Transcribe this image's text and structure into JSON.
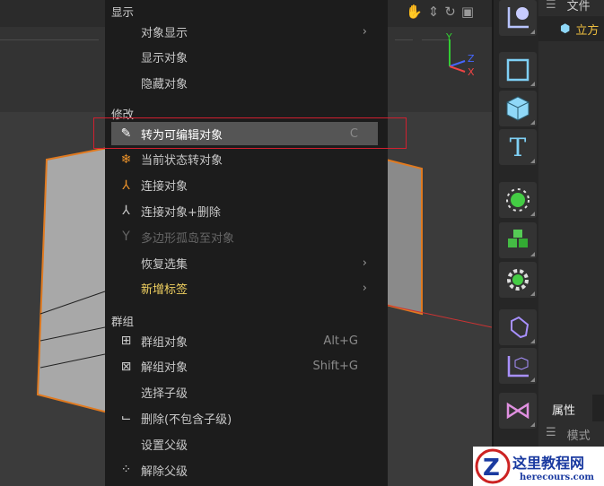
{
  "viewport": {
    "nav_icons": [
      "hand-icon",
      "move-icon",
      "rotate-icon",
      "maximize-icon"
    ],
    "axes": [
      "Y",
      "Z",
      "X"
    ]
  },
  "menu": {
    "sections": [
      {
        "title": "显示",
        "items": [
          {
            "label": "对象显示",
            "submenu": true
          },
          {
            "label": "显示对象"
          },
          {
            "label": "隐藏对象"
          }
        ]
      },
      {
        "title": "修改",
        "items": [
          {
            "label": "转为可编辑对象",
            "shortcut": "C",
            "icon": "edit-icon",
            "highlighted": true
          },
          {
            "label": "当前状态转对象",
            "icon": "snowflake-icon"
          },
          {
            "label": "连接对象",
            "icon": "connect-icon"
          },
          {
            "label": "连接对象+删除",
            "icon": "connect-delete-icon"
          },
          {
            "label": "多边形孤岛至对象",
            "icon": "polygon-island-icon",
            "disabled": true
          },
          {
            "label": "恢复选集",
            "submenu": true
          },
          {
            "label": "新增标签",
            "submenu": true
          }
        ]
      },
      {
        "title": "群组",
        "items": [
          {
            "label": "群组对象",
            "shortcut": "Alt+G",
            "icon": "group-icon"
          },
          {
            "label": "解组对象",
            "shortcut": "Shift+G",
            "icon": "ungroup-icon"
          },
          {
            "label": "选择子级"
          },
          {
            "label": "删除(不包含子级)",
            "icon": "delete-keep-children-icon"
          },
          {
            "label": "设置父级"
          },
          {
            "label": "解除父级",
            "icon": "unparent-icon"
          }
        ]
      }
    ]
  },
  "right_panel": {
    "file_label": "文件",
    "object_name": "立方",
    "attributes_tab": "属性",
    "mode_label": "模式"
  },
  "watermark": {
    "title": "这里教程网",
    "url": "herecours.com"
  }
}
